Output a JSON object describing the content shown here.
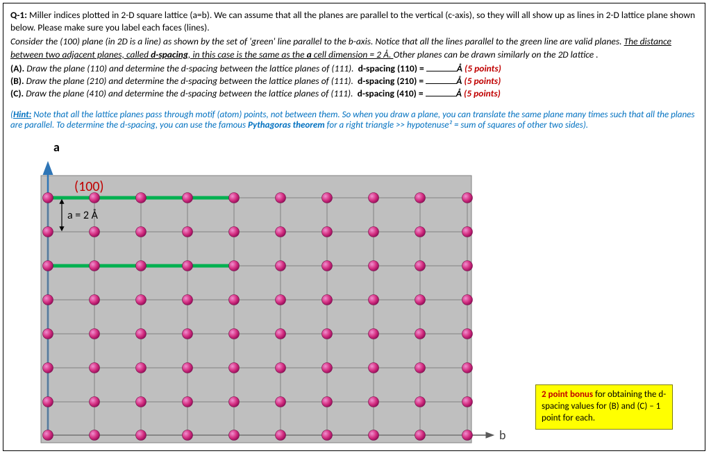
{
  "question": {
    "number": "Q-1:",
    "intro": "Miller indices plotted in 2-D square lattice (a=b).  We can assume that all the planes are parallel to the vertical (c-axis), so they will all show up as lines in 2-D lattice plane shown below.  Please make sure you label each faces (lines).",
    "para2_pre": "Consider the (100) plane (in 2D is a line) as shown by the set of 'green' line parallel to the b-axis.  Notice that all the lines parallel to the green line are valid planes.  ",
    "para2_ul": "The distance between two adjacent planes, called d-spacing, in this case is the same as the a cell dimension = 2 Å.  ",
    "para2_post": "Other planes can be drawn similarly on the 2D lattice .",
    "items": [
      {
        "label": "(A).",
        "text": "Draw the plane (110) and determine the d-spacing between the lattice planes of (111).",
        "ans_label": "d-spacing (110) =",
        "unit": "Å",
        "pts": "(5 points)"
      },
      {
        "label": "(B).",
        "text": "Draw the plane (210) and determine the d-spacing between the lattice planes of (111).",
        "ans_label": "d-spacing (210) =",
        "unit": "Å",
        "pts": "(5 points)"
      },
      {
        "label": "(C).",
        "text": "Draw the plane (410) and determine the d-spacing between the lattice planes of (111).",
        "ans_label": "d-spacing (410) =",
        "unit": "Å",
        "pts": "(5 points)"
      }
    ],
    "hint_label": "Hint:",
    "hint_body_pre": "Note that all the lattice planes pass through motif (atom) points, not between them.  So when you draw a plane, you can translate the same plane many times such that all the planes are parallel.  To determine the d-spacing, you can use the famous ",
    "hint_pyth": "Pythagoras theorem",
    "hint_body_post": " for a right triangle >> hypotenuse² = sum of squares of other two sides)."
  },
  "lattice": {
    "a_axis_label": "a",
    "b_axis_label": "b",
    "plane_label": "(100)",
    "cell_param_label": "a = 2 Å",
    "bonus_title": "2 point bonus",
    "bonus_text": " for obtaining the d-spacing values for (B) and (C) – 1 point for each."
  }
}
